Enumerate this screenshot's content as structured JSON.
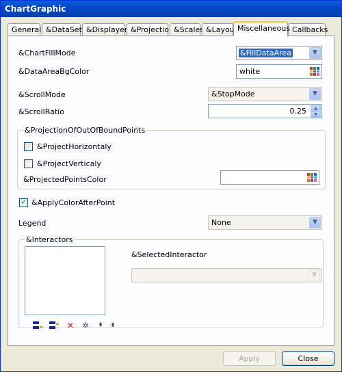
{
  "window": {
    "title": "ChartGraphic"
  },
  "tabs": [
    {
      "label": "General"
    },
    {
      "label": "&DataSets"
    },
    {
      "label": "&Displayers"
    },
    {
      "label": "&Projection"
    },
    {
      "label": "&Scales"
    },
    {
      "label": "&Layout"
    },
    {
      "label": "Miscellaneous"
    },
    {
      "label": "Callbacks"
    }
  ],
  "active_tab": "Miscellaneous",
  "misc": {
    "chart_fill_mode": {
      "label": "&ChartFillMode",
      "value": "&FillDataArea"
    },
    "data_area_bg_color": {
      "label": "&DataAreaBgColor",
      "value": "white"
    },
    "scroll_mode": {
      "label": "&ScrollMode",
      "value": "&StopMode"
    },
    "scroll_ratio": {
      "label": "&ScrollRatio",
      "value": "0.25"
    },
    "projection_group": {
      "title": "&ProjectionOfOutOfBoundPoints",
      "project_horizontaly": {
        "label": "&ProjectHorizontaly",
        "checked": false
      },
      "project_verticaly": {
        "label": "&ProjectVerticaly",
        "checked": false
      },
      "projected_points_color": {
        "label": "&ProjectedPointsColor",
        "value": ""
      }
    },
    "apply_color_after_point": {
      "label": "&ApplyColorAfterPoint",
      "checked": true
    },
    "legend": {
      "label": "Legend",
      "value": "None"
    },
    "interactors": {
      "title": "&Interactors",
      "selected_label": "&SelectedInteractor",
      "selected_value": "",
      "toolbar": [
        "add-first-icon",
        "add-last-icon",
        "delete-icon",
        "settings-icon",
        "move-up-icon",
        "move-down-icon"
      ]
    }
  },
  "buttons": {
    "apply": "Apply",
    "close": "Close"
  },
  "colors": {
    "accent": "#0a5fe0",
    "tab_highlight": "#ffc83c",
    "check": "#21a121"
  }
}
